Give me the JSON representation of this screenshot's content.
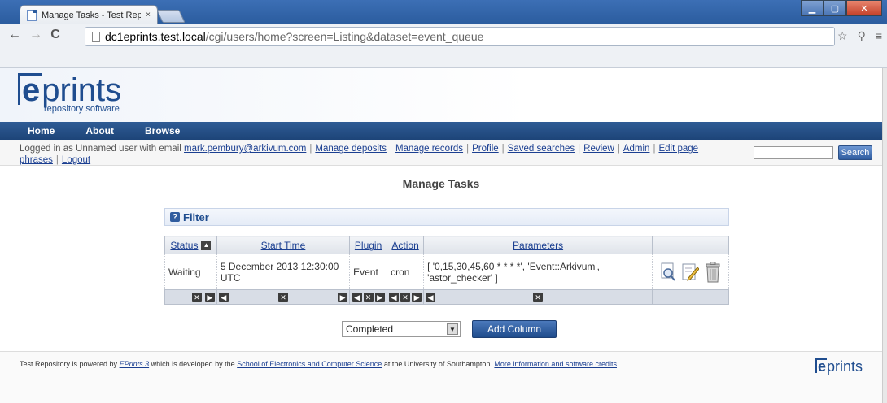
{
  "browser": {
    "tab_title": "Manage Tasks - Test Repo",
    "tab_close": "×",
    "url_host": "dc1eprints.test.local",
    "url_path": "/cgi/users/home?screen=Listing&dataset=event_queue",
    "back": "←",
    "forward": "→",
    "reload": "C",
    "menu": "≡",
    "star": "☆",
    "ext": "⚲"
  },
  "site": {
    "logo_e": "e",
    "logo_rest": "prints",
    "logo_sub": "repository software",
    "nav": [
      "Home",
      "About",
      "Browse"
    ]
  },
  "userbar": {
    "prefix": "Logged in as Unnamed user with email",
    "email": "mark.pembury@arkivum.com",
    "links": [
      "Manage deposits",
      "Manage records",
      "Profile",
      "Saved searches",
      "Review",
      "Admin",
      "Edit page phrases",
      "Logout"
    ],
    "search_label": "Search"
  },
  "page": {
    "title": "Manage Tasks",
    "filter_label": "Filter",
    "filter_icon": "?"
  },
  "table": {
    "headers": [
      "Status",
      "Start Time",
      "Plugin",
      "Action",
      "Parameters"
    ],
    "rows": [
      {
        "status": "Waiting",
        "start_time": "5 December 2013 12:30:00 UTC",
        "plugin": "Event",
        "action": "cron",
        "parameters": "[ '0,15,30,45,60 * * * *', 'Event::Arkivum', 'astor_checker' ]"
      }
    ]
  },
  "add_column": {
    "selected": "Completed",
    "button": "Add Column"
  },
  "footer": {
    "t1": "Test Repository is powered by",
    "eprints_link": "EPrints 3",
    "t2": "which is developed by the",
    "school_link": "School of Electronics and Computer Science",
    "t3": "at the University of Southampton.",
    "more_link": "More information and software credits",
    "t4": ".",
    "logo_e": "e",
    "logo_rest": "prints"
  }
}
